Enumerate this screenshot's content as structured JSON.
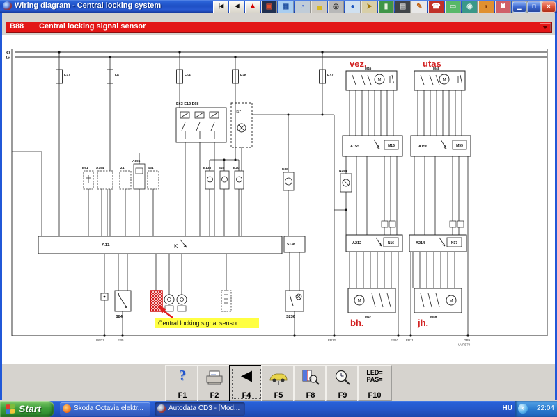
{
  "window": {
    "title": "Wiring diagram - Central locking system",
    "controls": {
      "minimize": "minimize",
      "maximize": "maximize",
      "close": "close"
    }
  },
  "toolbar": {
    "icons": [
      "nav-first",
      "nav-back",
      "warning",
      "screen",
      "wiring-diagrams",
      "gauge",
      "car",
      "wheel",
      "assistance",
      "key",
      "door",
      "radio",
      "pen",
      "phone",
      "printer",
      "camera",
      "helmet",
      "repair",
      "machine",
      "caution"
    ]
  },
  "selector": {
    "code": "B88",
    "label": "Central locking signal sensor"
  },
  "diagram": {
    "bus": [
      "30",
      "15"
    ],
    "fuses": [
      "F27",
      "F8",
      "F54",
      "F28",
      "F37"
    ],
    "relay_label": "E63  E12  E68",
    "h17": "H17",
    "mid": {
      "e91": "E91",
      "a154": "A154",
      "z1": "Z1",
      "a196": "A196",
      "s31": "S31",
      "e133": "E133",
      "e26": "E26",
      "e20": "E20",
      "n49": "N49",
      "n154": "N154"
    },
    "a11": "A11",
    "k_label": "K",
    "s138": "S138",
    "bottom": {
      "s84": "S84",
      "s236": "S236"
    },
    "motor_glyph": "M",
    "right": {
      "vez": "vez.",
      "utas": "utas",
      "bh": "bh.",
      "jh": "jh.",
      "m46": "M46",
      "m48": "M48",
      "a155": "A155",
      "a156": "A156",
      "m16": "M16",
      "m55": "M55",
      "a212": "A212",
      "a214": "A214",
      "n16": "N16",
      "n17": "N17",
      "m47": "M47",
      "m49": "M49"
    },
    "grounds": {
      "w": "W827",
      "ep5": "EP5",
      "ep12": "EP12",
      "ep10": "EP10",
      "ep11": "EP11",
      "gp": "GP9",
      "uv": "UVPE79"
    },
    "highlight": "Central locking signal sensor"
  },
  "fbar": {
    "buttons": [
      {
        "key": "F1"
      },
      {
        "key": "F2"
      },
      {
        "key": "F4"
      },
      {
        "key": "F5"
      },
      {
        "key": "F8"
      },
      {
        "key": "F9"
      },
      {
        "key": "F10"
      }
    ],
    "f10_line1": "LED=",
    "f10_line2": "PAS="
  },
  "taskbar": {
    "start_label": "Start",
    "tasks": [
      {
        "label": "Skoda Octavia elektr..."
      },
      {
        "label": "Autodata CD3 - [Mod..."
      }
    ],
    "tray": {
      "lang": "HU",
      "time": "22:04"
    }
  }
}
